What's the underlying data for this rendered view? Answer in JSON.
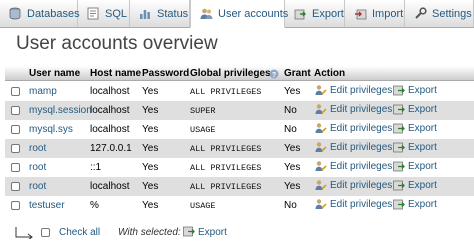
{
  "tabs": [
    {
      "label": "Databases",
      "icon": "database-icon",
      "active": false
    },
    {
      "label": "SQL",
      "icon": "sql-icon",
      "active": false
    },
    {
      "label": "Status",
      "icon": "status-icon",
      "active": false
    },
    {
      "label": "User accounts",
      "icon": "users-icon",
      "active": true
    },
    {
      "label": "Export",
      "icon": "export-icon",
      "active": false
    },
    {
      "label": "Import",
      "icon": "import-icon",
      "active": false
    },
    {
      "label": "Settings",
      "icon": "settings-icon",
      "active": false
    }
  ],
  "page": {
    "title": "User accounts overview"
  },
  "table": {
    "headers": {
      "user_name": "User name",
      "host_name": "Host name",
      "password": "Password",
      "global_privileges": "Global privileges",
      "grant": "Grant",
      "action": "Action"
    },
    "rows": [
      {
        "user": "mamp",
        "host": "localhost",
        "password": "Yes",
        "privileges": "ALL PRIVILEGES",
        "grant": "Yes"
      },
      {
        "user": "mysql.session",
        "host": "localhost",
        "password": "Yes",
        "privileges": "SUPER",
        "grant": "No"
      },
      {
        "user": "mysql.sys",
        "host": "localhost",
        "password": "Yes",
        "privileges": "USAGE",
        "grant": "No"
      },
      {
        "user": "root",
        "host": "127.0.0.1",
        "password": "Yes",
        "privileges": "ALL PRIVILEGES",
        "grant": "Yes"
      },
      {
        "user": "root",
        "host": "::1",
        "password": "Yes",
        "privileges": "ALL PRIVILEGES",
        "grant": "Yes"
      },
      {
        "user": "root",
        "host": "localhost",
        "password": "Yes",
        "privileges": "ALL PRIVILEGES",
        "grant": "Yes"
      },
      {
        "user": "testuser",
        "host": "%",
        "password": "Yes",
        "privileges": "USAGE",
        "grant": "No"
      }
    ],
    "actions": {
      "edit_label": "Edit privileges",
      "export_label": "Export"
    }
  },
  "footer": {
    "check_all": "Check all",
    "with_selected": "With selected:",
    "export_label": "Export"
  },
  "colors": {
    "link": "#235a81",
    "row_alt": "#dfdfdf"
  }
}
